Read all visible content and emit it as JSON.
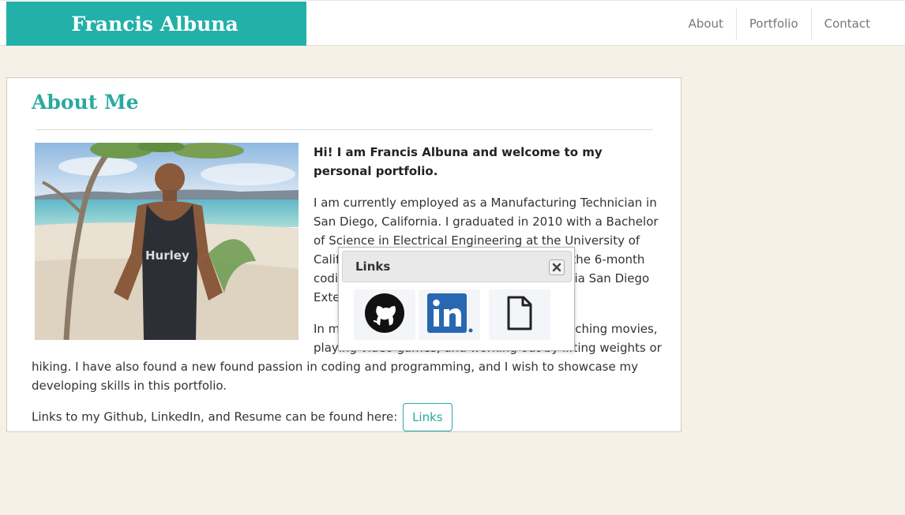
{
  "brand": {
    "name": "Francis Albuna",
    "color": "#22b0a8"
  },
  "nav": {
    "items": [
      "About",
      "Portfolio",
      "Contact"
    ]
  },
  "about": {
    "title": "About Me",
    "intro": "Hi! I am Francis Albuna and welcome to my personal portfolio.",
    "para1": "I am currently employed as a Manufacturing Technician in San Diego, California. I graduated in 2010 with a Bachelor of Science in Electrical Engineering at the University of California, Irvine. I am currently enrolled in the 6-month coding program at the University of California San Diego Extension.",
    "para2": "In my spare time, I enjoy spending time watching movies, playing video games, and working out by lifting weights or hiking. I have also found a new found passion in coding and programming, and I wish to showcase my developing skills in this portfolio.",
    "links_text": "Links to my Github, LinkedIn, and Resume can be found here:",
    "links_button": "Links"
  },
  "modal": {
    "title": "Links",
    "items": [
      "github-icon",
      "linkedin-icon",
      "document-icon"
    ]
  },
  "colors": {
    "accent": "#2aa9a0",
    "background": "#f5f1e6",
    "linkedin": "#2867b2"
  }
}
